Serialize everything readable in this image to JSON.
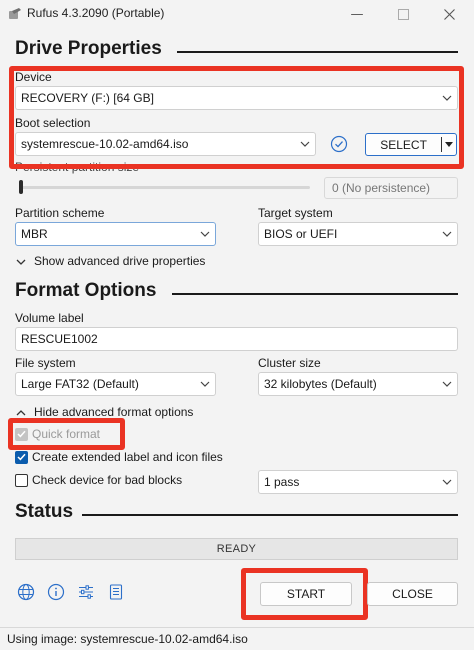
{
  "window": {
    "title": "Rufus 4.3.2090 (Portable)"
  },
  "drive_properties": {
    "heading": "Drive Properties",
    "device_label": "Device",
    "device_value": "RECOVERY (F:) [64 GB]",
    "boot_label": "Boot selection",
    "boot_value": "systemrescue-10.02-amd64.iso",
    "select_button": "SELECT",
    "persistent_label": "Persistent partition size",
    "persistence_value": "0 (No persistence)",
    "persistence_fraction": 0,
    "partition_label": "Partition scheme",
    "partition_value": "MBR",
    "target_label": "Target system",
    "target_value": "BIOS or UEFI",
    "advanced_toggle": "Show advanced drive properties"
  },
  "format_options": {
    "heading": "Format Options",
    "volume_label_label": "Volume label",
    "volume_label_value": "RESCUE1002",
    "filesystem_label": "File system",
    "filesystem_value": "Large FAT32 (Default)",
    "cluster_label": "Cluster size",
    "cluster_value": "32 kilobytes (Default)",
    "advanced_toggle": "Hide advanced format options",
    "quick_format": "Quick format",
    "extended_label": "Create extended label and icon files",
    "bad_blocks": "Check device for bad blocks",
    "passes_value": "1 pass"
  },
  "status": {
    "heading": "Status",
    "progress_text": "READY",
    "progress_fraction": 0,
    "start_button": "START",
    "close_button": "CLOSE"
  },
  "status_bar": {
    "text": "Using image: systemrescue-10.02-amd64.iso"
  },
  "icons": [
    "globe-icon",
    "info-icon",
    "settings-sliders-icon",
    "log-icon",
    "check-hash-icon"
  ],
  "colors": {
    "highlight": "#ea3323",
    "accent": "#0b5cad",
    "select_border": "#2c6fc9"
  }
}
